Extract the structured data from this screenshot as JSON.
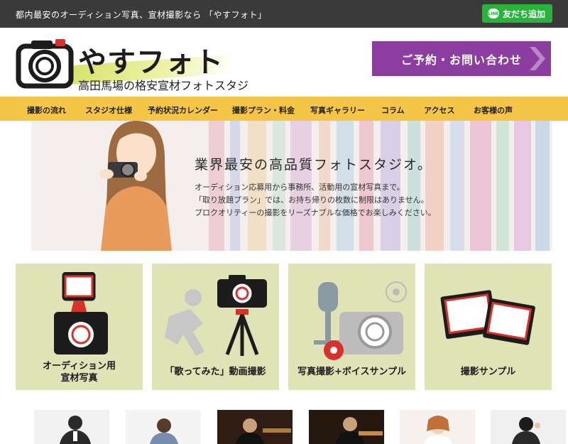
{
  "topbar": {
    "tagline": "都内最安のオーディション写真、宣材撮影なら 「やすフォト」",
    "line_button": "友だち追加",
    "line_icon_text": "LINE"
  },
  "header": {
    "brand": "やすフォト",
    "subtitle": "高田馬場の格安宣材フォトスタジオ",
    "cta": "ご予約・お問い合わせ"
  },
  "nav": {
    "items": [
      "撮影の流れ",
      "スタジオ仕様",
      "予約状況カレンダー",
      "撮影プラン・料金",
      "写真ギャラリー",
      "コラム",
      "アクセス",
      "お客様の声"
    ]
  },
  "hero": {
    "title": "業界最安の高品質フォトスタジオ。",
    "lines": [
      "オーディション応募用から事務所、活動用の宣材写真まで。",
      "「取り放題プラン」では、お持ち帰りの枚数に制限はありません。",
      "プロクオリティーの撮影をリーズナブルな価格でお楽しみください。"
    ]
  },
  "cards": [
    {
      "line1": "オーディション用",
      "line2": "宣材写真"
    },
    {
      "line1": "「歌ってみた」動画撮影"
    },
    {
      "line1": "写真撮影+ボイスサンプル"
    },
    {
      "line1": "撮影サンプル"
    }
  ],
  "colors": {
    "topbar": "#3a3a3a",
    "line_green": "#27b43a",
    "cta_purple": "#8b3ea0",
    "nav_yellow": "#f5c548",
    "card_bg": "#e0e3b6",
    "accent_red": "#d8312b"
  }
}
